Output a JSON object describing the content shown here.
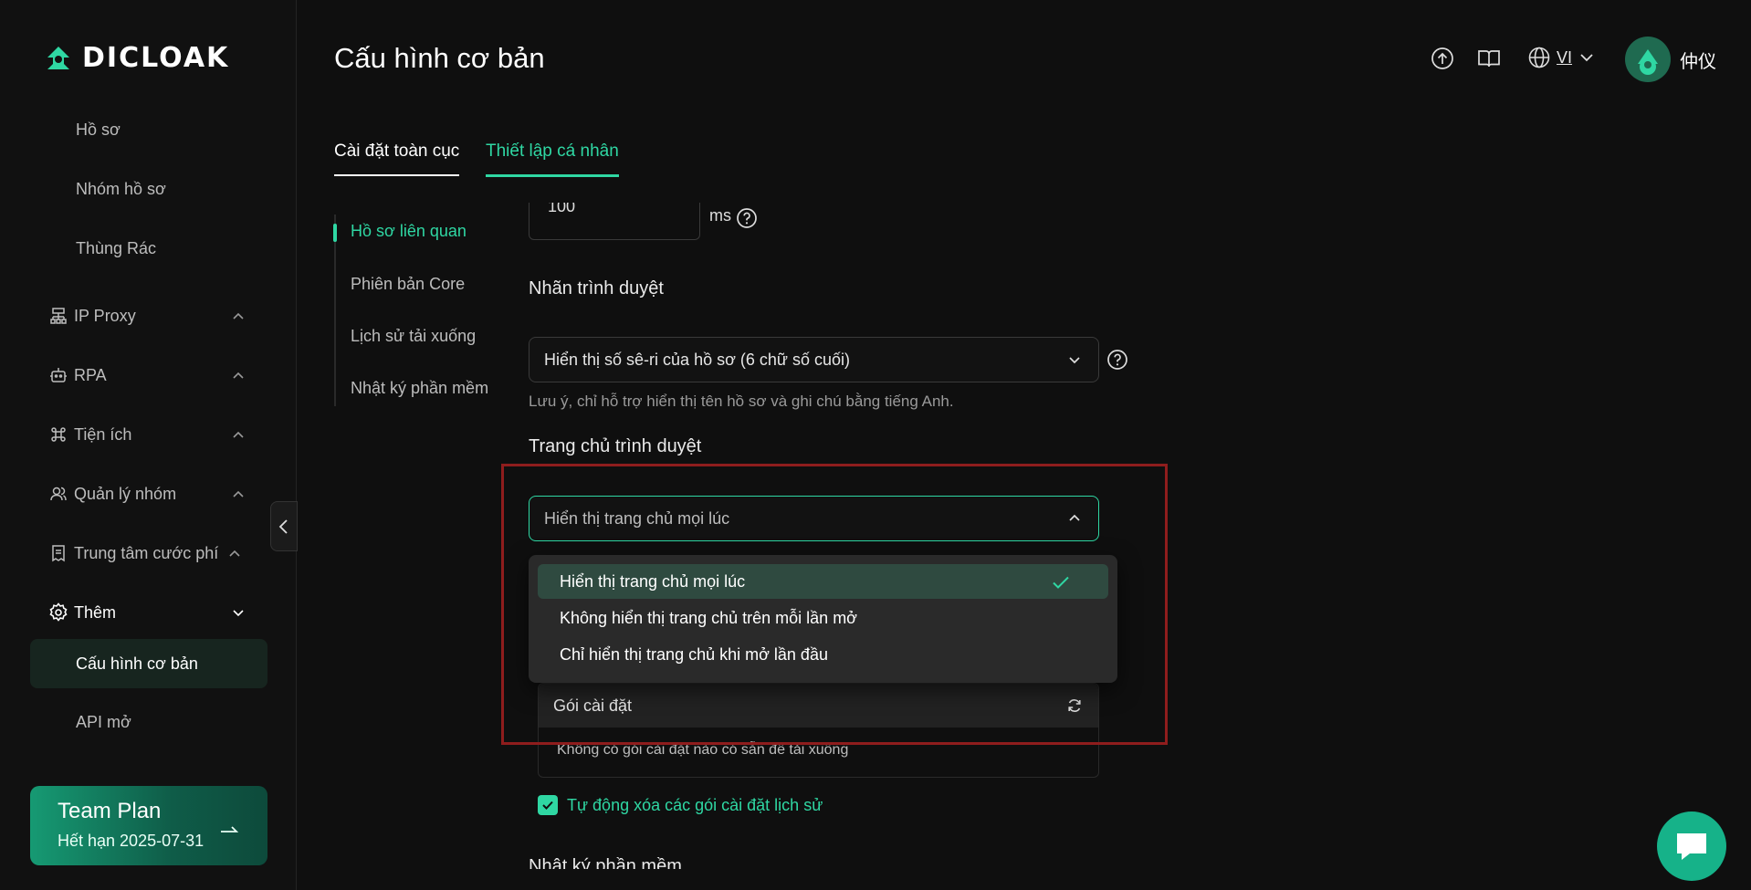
{
  "brand": {
    "name": "DICLOAK",
    "accent": "#2fd7a3"
  },
  "sidebar": {
    "items": [
      {
        "label": "Hồ sơ"
      },
      {
        "label": "Nhóm hồ sơ"
      },
      {
        "label": "Thùng Rác"
      },
      {
        "label": "IP Proxy",
        "icon": "network-icon"
      },
      {
        "label": "RPA",
        "icon": "robot-icon"
      },
      {
        "label": "Tiện ích",
        "icon": "command-icon"
      },
      {
        "label": "Quản lý nhóm",
        "icon": "users-icon"
      },
      {
        "label": "Trung tâm cước phí",
        "icon": "billing-icon"
      },
      {
        "label": "Thêm",
        "icon": "gear-icon"
      },
      {
        "label": "Cấu hình cơ bản"
      },
      {
        "label": "API mở"
      }
    ],
    "plan": {
      "title": "Team Plan",
      "expiry": "Hết hạn 2025-07-31"
    }
  },
  "header": {
    "title": "Cấu hình cơ bản",
    "lang": "VI",
    "username": "仲仪"
  },
  "tabs": [
    {
      "label": "Cài đặt toàn cục"
    },
    {
      "label": "Thiết lập cá nhân"
    }
  ],
  "subnav": [
    {
      "label": "Hồ sơ liên quan"
    },
    {
      "label": "Phiên bản Core"
    },
    {
      "label": "Lịch sử tải xuống"
    },
    {
      "label": "Nhật ký phần mềm"
    }
  ],
  "content": {
    "delay_value": "100",
    "delay_unit": "ms",
    "browser_label": {
      "title": "Nhãn trình duyệt",
      "value": "Hiển thị số sê-ri của hồ sơ (6 chữ số cuối)",
      "note": "Lưu ý, chỉ hỗ trợ hiển thị tên hồ sơ và ghi chú bằng tiếng Anh."
    },
    "homepage": {
      "title": "Trang chủ trình duyệt",
      "value": "Hiển thị trang chủ mọi lúc",
      "options": [
        "Hiển thị trang chủ mọi lúc",
        "Không hiển thị trang chủ trên mỗi lần mở",
        "Chỉ hiển thị trang chủ khi mở lần đầu"
      ]
    },
    "packages": {
      "title": "Gói cài đặt",
      "empty": "Không có gói cài đặt nào có sẵn để tải xuống"
    },
    "auto_delete": "Tự động xóa các gói cài đặt lịch sử",
    "next_section": "Nhật ký phần mềm"
  }
}
